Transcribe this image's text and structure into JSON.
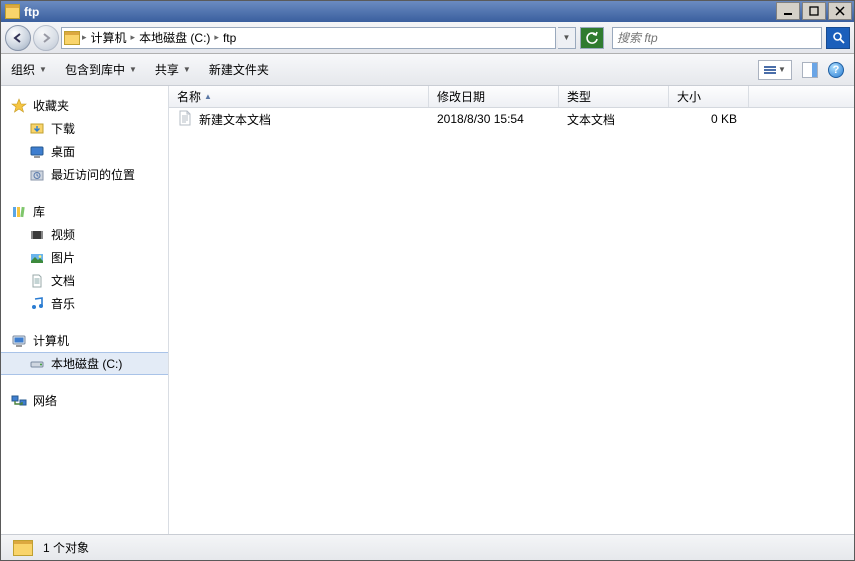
{
  "window": {
    "title": "ftp"
  },
  "nav": {
    "crumbs": [
      "计算机",
      "本地磁盘 (C:)",
      "ftp"
    ],
    "search_placeholder": "搜索 ftp"
  },
  "toolbar": {
    "organize": "组织",
    "include": "包含到库中",
    "share": "共享",
    "newfolder": "新建文件夹"
  },
  "sidebar": {
    "favorites": {
      "label": "收藏夹",
      "items": [
        {
          "label": "下载"
        },
        {
          "label": "桌面"
        },
        {
          "label": "最近访问的位置"
        }
      ]
    },
    "libraries": {
      "label": "库",
      "items": [
        {
          "label": "视频"
        },
        {
          "label": "图片"
        },
        {
          "label": "文档"
        },
        {
          "label": "音乐"
        }
      ]
    },
    "computer": {
      "label": "计算机",
      "items": [
        {
          "label": "本地磁盘 (C:)",
          "selected": true
        }
      ]
    },
    "network": {
      "label": "网络"
    }
  },
  "columns": {
    "name": "名称",
    "date": "修改日期",
    "type": "类型",
    "size": "大小"
  },
  "files": [
    {
      "name": "新建文本文档",
      "date": "2018/8/30 15:54",
      "type": "文本文档",
      "size": "0 KB"
    }
  ],
  "status": {
    "text": "1 个对象"
  }
}
